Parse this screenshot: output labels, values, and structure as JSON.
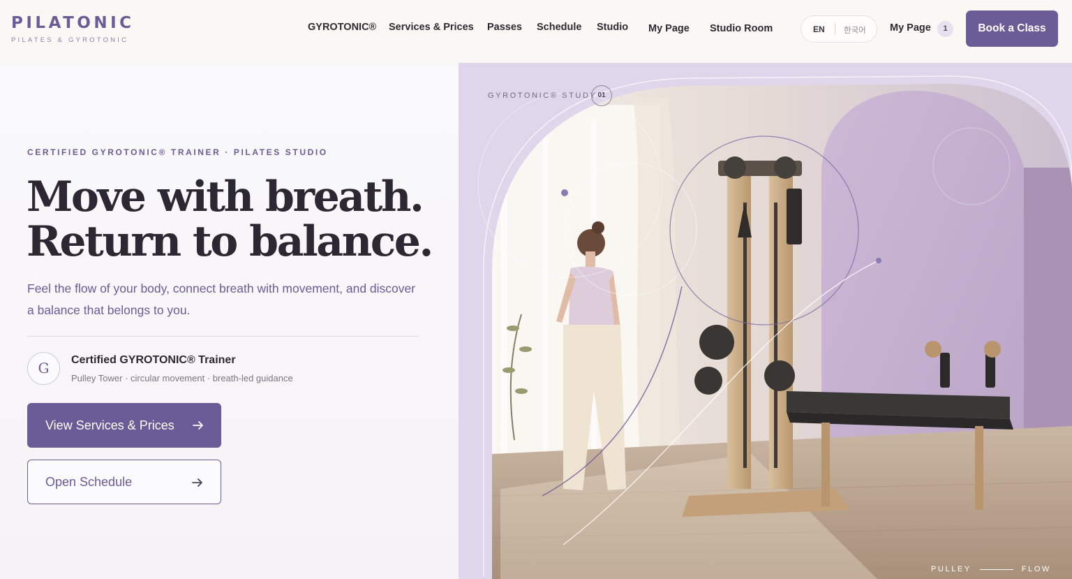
{
  "brand": {
    "name": "PILATONIC",
    "tagline": "PILATES & GYROTONIC"
  },
  "nav": {
    "items": [
      "GYROTONIC®",
      "Services & Prices",
      "Passes",
      "Schedule",
      "Studio",
      "My Page",
      "Studio Room"
    ],
    "lang_en": "EN",
    "lang_ko": "한국어",
    "account_label": "My Page",
    "account_badge": "1",
    "cta": "Book a Class"
  },
  "hero": {
    "eyebrow": "CERTIFIED GYROTONIC® TRAINER · PILATES STUDIO",
    "headline_line1": "Move with breath.",
    "headline_line2": "Return to balance.",
    "subtitle": "Feel the flow of your body, connect breath with movement, and discover a balance that belongs to you.",
    "cert_initial": "G",
    "cert_title": "Certified GYROTONIC® Trainer",
    "cert_sub": "Pulley Tower · circular movement · breath-led guidance",
    "primary_button": "View Services & Prices",
    "secondary_button": "Open Schedule"
  },
  "visual": {
    "study_label": "GYROTONIC® STUDY",
    "study_number": "01",
    "flow_left": "PULLEY",
    "flow_right": "FLOW"
  },
  "colors": {
    "accent": "#6b5b96",
    "panel": "#dfd6ec",
    "header_bg": "#faf8f4"
  }
}
